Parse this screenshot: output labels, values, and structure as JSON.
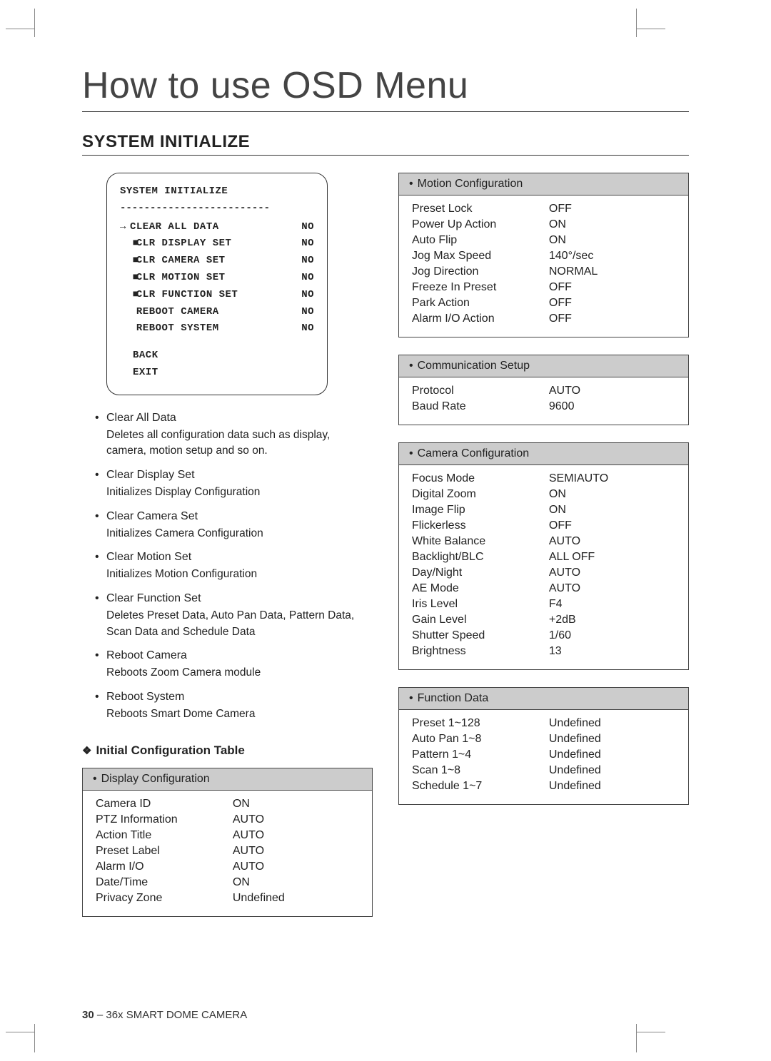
{
  "page": {
    "title": "How to use OSD Menu",
    "section": "SYSTEM INITIALIZE",
    "footer_page": "30",
    "footer_sep": " – ",
    "footer_text": "36x SMART DOME CAMERA"
  },
  "osd": {
    "title": "SYSTEM INITIALIZE",
    "dashes": "-------------------------",
    "items": [
      {
        "prefix": "→",
        "label": "CLEAR ALL DATA",
        "value": "NO"
      },
      {
        "prefix": "■",
        "indent": true,
        "label": "CLR DISPLAY SET",
        "value": "NO"
      },
      {
        "prefix": "■",
        "indent": true,
        "label": "CLR CAMERA SET",
        "value": "NO"
      },
      {
        "prefix": "■",
        "indent": true,
        "label": "CLR MOTION SET",
        "value": "NO"
      },
      {
        "prefix": "■",
        "indent": true,
        "label": "CLR FUNCTION SET",
        "value": "NO"
      },
      {
        "prefix": "",
        "indent": true,
        "label": " REBOOT CAMERA",
        "value": "NO"
      },
      {
        "prefix": "",
        "indent": true,
        "label": " REBOOT SYSTEM",
        "value": "NO"
      }
    ],
    "back": "BACK",
    "exit": "EXIT"
  },
  "desc": [
    {
      "t": "Clear All Data",
      "d": "Deletes all configuration data such as display, camera, motion setup and so on."
    },
    {
      "t": "Clear Display Set",
      "d": "Initializes Display Configuration"
    },
    {
      "t": "Clear Camera Set",
      "d": "Initializes Camera Configuration"
    },
    {
      "t": "Clear Motion Set",
      "d": "Initializes Motion Configuration"
    },
    {
      "t": "Clear Function Set",
      "d": "Deletes Preset Data, Auto Pan Data, Pattern Data, Scan Data and Schedule Data"
    },
    {
      "t": "Reboot Camera",
      "d": "Reboots Zoom Camera module"
    },
    {
      "t": "Reboot System",
      "d": "Reboots Smart Dome Camera"
    }
  ],
  "subheading": "Initial Configuration Table",
  "tables": {
    "display": {
      "title": "Display Configuration",
      "rows": [
        {
          "k": "Camera ID",
          "v": "ON"
        },
        {
          "k": "PTZ Information",
          "v": "AUTO"
        },
        {
          "k": "Action Title",
          "v": "AUTO"
        },
        {
          "k": "Preset Label",
          "v": "AUTO"
        },
        {
          "k": "Alarm I/O",
          "v": "AUTO"
        },
        {
          "k": "Date/Time",
          "v": "ON"
        },
        {
          "k": "Privacy Zone",
          "v": "Undefined"
        }
      ]
    },
    "motion": {
      "title": "Motion Configuration",
      "rows": [
        {
          "k": "Preset Lock",
          "v": "OFF"
        },
        {
          "k": "Power Up Action",
          "v": "ON"
        },
        {
          "k": "Auto Flip",
          "v": "ON"
        },
        {
          "k": "Jog Max Speed",
          "v": "140°/sec"
        },
        {
          "k": "Jog Direction",
          "v": "NORMAL"
        },
        {
          "k": "Freeze In Preset",
          "v": "OFF"
        },
        {
          "k": "Park Action",
          "v": "OFF"
        },
        {
          "k": "Alarm I/O Action",
          "v": "OFF"
        }
      ]
    },
    "comm": {
      "title": "Communication Setup",
      "rows": [
        {
          "k": "Protocol",
          "v": "AUTO"
        },
        {
          "k": "Baud Rate",
          "v": "9600"
        }
      ]
    },
    "camera": {
      "title": "Camera Configuration",
      "rows": [
        {
          "k": "Focus Mode",
          "v": "SEMIAUTO"
        },
        {
          "k": "Digital Zoom",
          "v": "ON"
        },
        {
          "k": "Image Flip",
          "v": "ON"
        },
        {
          "k": "Flickerless",
          "v": "OFF"
        },
        {
          "k": "White Balance",
          "v": "AUTO"
        },
        {
          "k": "Backlight/BLC",
          "v": "ALL OFF"
        },
        {
          "k": "Day/Night",
          "v": "AUTO"
        },
        {
          "k": "AE Mode",
          "v": "AUTO"
        },
        {
          "k": "Iris Level",
          "v": "F4"
        },
        {
          "k": "Gain Level",
          "v": "+2dB"
        },
        {
          "k": "Shutter Speed",
          "v": "1/60"
        },
        {
          "k": "Brightness",
          "v": "13"
        }
      ]
    },
    "func": {
      "title": "Function Data",
      "rows": [
        {
          "k": "Preset 1~128",
          "v": "Undefined"
        },
        {
          "k": "Auto Pan 1~8",
          "v": "Undefined"
        },
        {
          "k": "Pattern 1~4",
          "v": "Undefined"
        },
        {
          "k": "Scan 1~8",
          "v": "Undefined"
        },
        {
          "k": "Schedule 1~7",
          "v": "Undefined"
        }
      ]
    }
  }
}
